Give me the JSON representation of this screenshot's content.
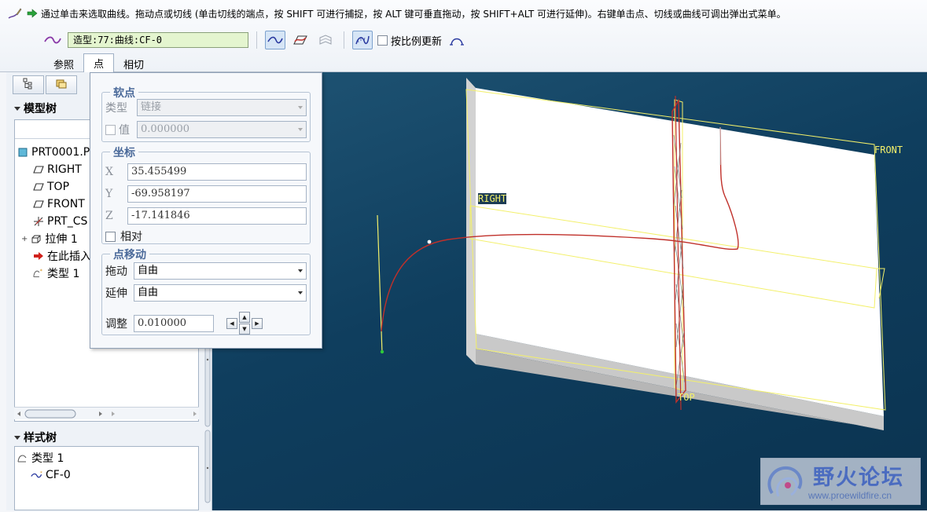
{
  "message": {
    "text": "通过单击来选取曲线。拖动点或切线 (单击切线的端点，按 SHIFT 可进行捕捉，按 ALT 键可垂直拖动，按 SHIFT+ALT 可进行延伸)。右键单击点、切线或曲线可调出弹出式菜单。"
  },
  "toolbar": {
    "curve_field": "造型:77:曲线:CF-0",
    "scale_update_label": "按比例更新"
  },
  "tabs": [
    {
      "label": "参照",
      "active": false
    },
    {
      "label": "点",
      "active": true
    },
    {
      "label": "相切",
      "active": false
    }
  ],
  "navigator": {
    "model_tree_title": "模型树",
    "model_tree_items": [
      {
        "label": "PRT0001.P",
        "icon": "part-icon"
      },
      {
        "label": "RIGHT",
        "icon": "datum-plane-icon"
      },
      {
        "label": "TOP",
        "icon": "datum-plane-icon"
      },
      {
        "label": "FRONT",
        "icon": "datum-plane-icon"
      },
      {
        "label": "PRT_CS",
        "icon": "coordinate-system-icon"
      },
      {
        "label": "拉伸 1",
        "icon": "extrude-icon"
      },
      {
        "label": "在此插入",
        "icon": "insert-here-arrow-icon"
      },
      {
        "label": "类型 1",
        "icon": "style-feature-icon"
      }
    ],
    "style_tree_title": "样式树",
    "style_tree_items": [
      {
        "label": "类型 1",
        "icon": "style-feature-icon"
      },
      {
        "label": "CF-0",
        "icon": "curve-icon"
      }
    ]
  },
  "point_panel": {
    "soft_point": {
      "title": "软点",
      "type_label": "类型",
      "type_value": "链接",
      "value_label": "值",
      "value_value": "0.000000"
    },
    "coordinates": {
      "title": "坐标",
      "x_label": "X",
      "x_value": "35.455499",
      "y_label": "Y",
      "y_value": "-69.958197",
      "z_label": "Z",
      "z_value": "-17.141846",
      "relative_label": "相对"
    },
    "point_move": {
      "title": "点移动",
      "drag_label": "拖动",
      "drag_value": "自由",
      "extend_label": "延伸",
      "extend_value": "自由",
      "adjust_label": "调整",
      "adjust_value": "0.010000"
    }
  },
  "graphics": {
    "labels": {
      "front": "FRONT",
      "right": "RIGHT",
      "top": "TOP"
    },
    "colors": {
      "background": "#0f3e5e",
      "solid_face": "#ffffff",
      "solid_side": "#c8c8c8",
      "datum": "#f3f06a",
      "curve": "#c0302a"
    }
  },
  "watermark": {
    "title": "野火论坛",
    "url": "www.proewildfire.cn"
  }
}
